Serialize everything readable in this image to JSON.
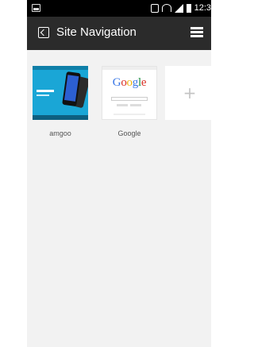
{
  "status_bar": {
    "time": "12:3",
    "icons": [
      "image-icon",
      "vibrate-icon",
      "wifi-icon",
      "signal-icon",
      "battery-icon"
    ]
  },
  "action_bar": {
    "title": "Site Navigation",
    "background": "#2b2b2b",
    "icons": [
      "site-navigation-icon",
      "menu-icon"
    ]
  },
  "tiles": [
    {
      "label": "amgoo",
      "thumbnail": "amgoo website preview"
    },
    {
      "label": "Google",
      "thumbnail": "google website preview",
      "logo_text": "Google"
    },
    {
      "label": "",
      "icon": "add-icon",
      "symbol": "+"
    }
  ],
  "colors": {
    "amgoo_blue": "#1aa6d6",
    "content_background": "#f2f2f2"
  }
}
